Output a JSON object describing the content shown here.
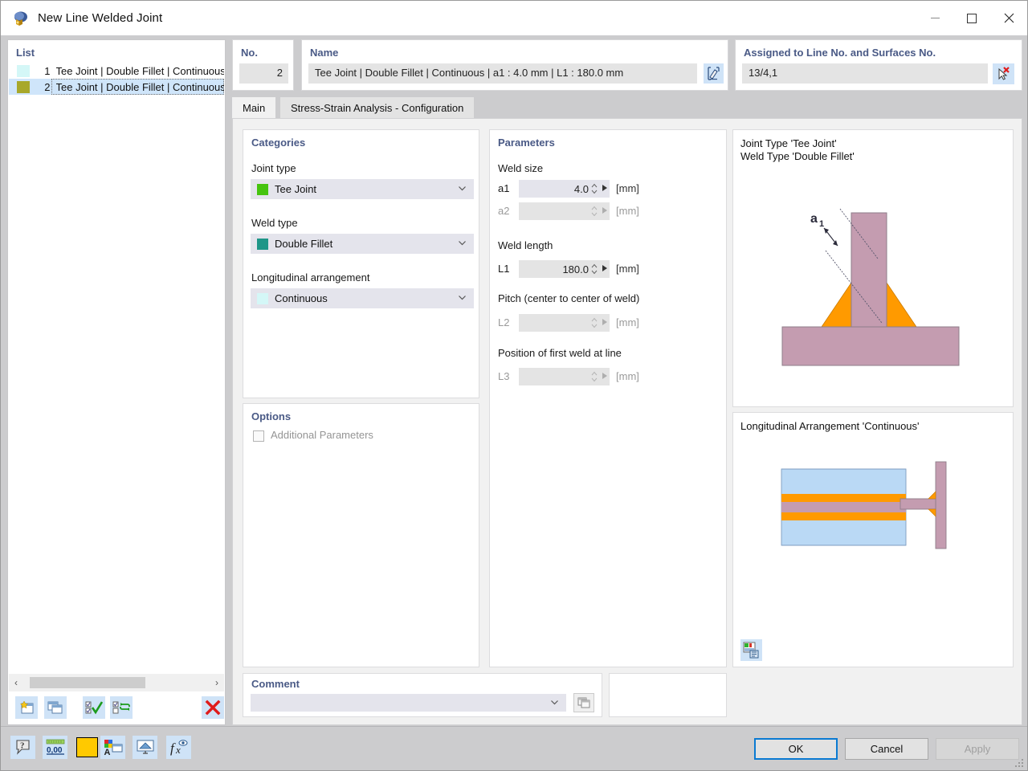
{
  "window": {
    "title": "New Line Welded Joint",
    "app_icon": "welded-joint-icon",
    "minimize_label": "Minimize",
    "maximize_label": "Maximize",
    "close_label": "Close"
  },
  "list": {
    "header": "List",
    "rows": [
      {
        "num": "1",
        "label": "Tee Joint | Double Fillet | Continuous |",
        "color": "#d4f7f7",
        "selected": false
      },
      {
        "num": "2",
        "label": "Tee Joint | Double Fillet | Continuous |",
        "color": "#a8a82b",
        "selected": true
      }
    ],
    "scroll_left": "‹",
    "scroll_right": "›",
    "toolbar": [
      {
        "name": "new-item-button",
        "icon": "new-window-icon"
      },
      {
        "name": "copy-item-button",
        "icon": "copy-windows-icon"
      },
      {
        "name": "select-all-button",
        "icon": "checklist-check-icon"
      },
      {
        "name": "invert-selection-button",
        "icon": "checklist-swap-icon"
      },
      {
        "name": "delete-item-button",
        "icon": "red-x-icon"
      }
    ]
  },
  "no_group": {
    "title": "No.",
    "value": "2"
  },
  "name_group": {
    "title": "Name",
    "value": "Tee Joint | Double Fillet | Continuous | a1 : 4.0 mm | L1 : 180.0 mm",
    "edit_button_icon": "pencil-edit-icon"
  },
  "assigned_group": {
    "title": "Assigned to Line No. and Surfaces No.",
    "value": "13/4,1",
    "pick_button_icon": "pick-cursor-icon"
  },
  "tabs": [
    {
      "label": "Main",
      "active": true
    },
    {
      "label": "Stress-Strain Analysis - Configuration",
      "active": false
    }
  ],
  "categories": {
    "title": "Categories",
    "fields": [
      {
        "label": "Joint type",
        "value": "Tee Joint",
        "swatch": "#46c410"
      },
      {
        "label": "Weld type",
        "value": "Double Fillet",
        "swatch": "#1f9688"
      },
      {
        "label": "Longitudinal arrangement",
        "value": "Continuous",
        "swatch": "#d4f7f7"
      }
    ]
  },
  "options": {
    "title": "Options",
    "checkbox_label": "Additional Parameters",
    "checked": false,
    "enabled": false
  },
  "parameters": {
    "title": "Parameters",
    "groups": [
      {
        "label": "Weld size",
        "rows": [
          {
            "name": "a1",
            "value": "4.0",
            "unit": "[mm]",
            "enabled": true
          },
          {
            "name": "a2",
            "value": "",
            "unit": "[mm]",
            "enabled": false
          }
        ]
      },
      {
        "label": "Weld length",
        "rows": [
          {
            "name": "L1",
            "value": "180.0",
            "unit": "[mm]",
            "enabled": true
          }
        ]
      },
      {
        "label": "Pitch (center to center of weld)",
        "rows": [
          {
            "name": "L2",
            "value": "",
            "unit": "[mm]",
            "enabled": false
          }
        ]
      },
      {
        "label": "Position of first weld at line",
        "rows": [
          {
            "name": "L3",
            "value": "",
            "unit": "[mm]",
            "enabled": false
          }
        ]
      }
    ]
  },
  "preview_top": {
    "caption_line1": "Joint Type 'Tee Joint'",
    "caption_line2": "Weld Type 'Double Fillet'",
    "dimension_label": "a₁",
    "colors": {
      "plate": "#c49cb0",
      "weld": "#ff9a00",
      "outline": "#8e7e8a"
    }
  },
  "preview_bottom": {
    "caption": "Longitudinal Arrangement 'Continuous'",
    "button_icon": "image-export-icon",
    "colors": {
      "surface": "#bad9f5",
      "plate": "#c49cb0",
      "weld": "#ff9a00"
    }
  },
  "comment": {
    "title": "Comment",
    "value": "",
    "copy_button_icon": "copy-windows-icon"
  },
  "bottom_toolbar": [
    {
      "name": "help-button",
      "icon": "help-balloon-icon"
    },
    {
      "name": "units-button",
      "icon": "units-000-icon"
    },
    {
      "name": "color-button",
      "icon": "yellow-color-swatch-icon"
    },
    {
      "name": "display-properties-button",
      "icon": "display-properties-icon"
    },
    {
      "name": "view-button",
      "icon": "view-monitor-icon"
    },
    {
      "name": "formula-button",
      "icon": "fx-formula-icon"
    }
  ],
  "dialog_buttons": [
    {
      "label": "OK",
      "name": "ok-button",
      "style": "default"
    },
    {
      "label": "Cancel",
      "name": "cancel-button",
      "style": "normal"
    },
    {
      "label": "Apply",
      "name": "apply-button",
      "style": "disabled"
    }
  ]
}
